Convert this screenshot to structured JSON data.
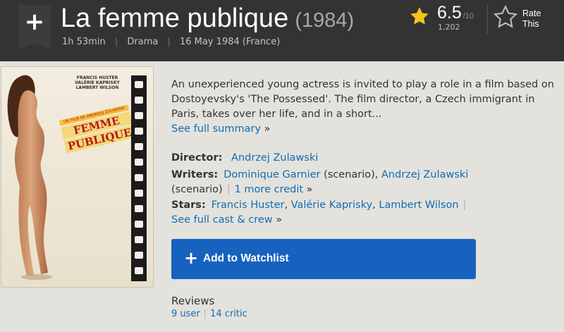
{
  "header": {
    "add_icon": "plus-icon",
    "title": "La femme publique",
    "year": "(1984)",
    "runtime": "1h 53min",
    "genre": "Drama",
    "release": "16 May 1984 (France)",
    "rating": {
      "value": "6.5",
      "max": "/10",
      "count": "1,202",
      "star_icon": "star-icon",
      "star_color": "#f5c518"
    },
    "rate_this": {
      "line1": "Rate",
      "line2": "This",
      "icon": "star-outline-icon"
    }
  },
  "poster": {
    "credits_line1": "FRANCIS HUSTER",
    "credits_line2": "VALÉRIE KAPRISKY",
    "credits_line3": "LAMBERT WILSON",
    "band_text": "UN FILM DE ANDRZEJ ZULAWSKI",
    "title_line1": "FEMME",
    "title_line2": "PUBLIQUE"
  },
  "summary": {
    "text": "An unexperienced young actress is invited to play a role in a film based on Dostoyevsky's 'The Possessed'. The film director, a Czech immigrant in Paris, takes over her life, and in a short...",
    "full_summary_link": "See full summary",
    "arrow": "»"
  },
  "credits": {
    "director_label": "Director:",
    "director": "Andrzej Zulawski",
    "writers_label": "Writers:",
    "writer1": "Dominique Garnier",
    "writer1_role": " (scenario), ",
    "writer2": "Andrzej Zulawski",
    "writer2_role": "(scenario)",
    "more_credit": "1 more credit",
    "stars_label": "Stars:",
    "star1": "Francis Huster",
    "star2": "Valérie Kaprisky",
    "star3": "Lambert Wilson",
    "full_cast_link": "See full cast & crew",
    "comma": ",",
    "pipe": "|",
    "arrow": "»"
  },
  "watchlist": {
    "plus": "+",
    "label": "Add to Watchlist",
    "color": "#1762be"
  },
  "reviews": {
    "title": "Reviews",
    "user": "9 user",
    "critic": "14 critic",
    "pipe": "|"
  }
}
